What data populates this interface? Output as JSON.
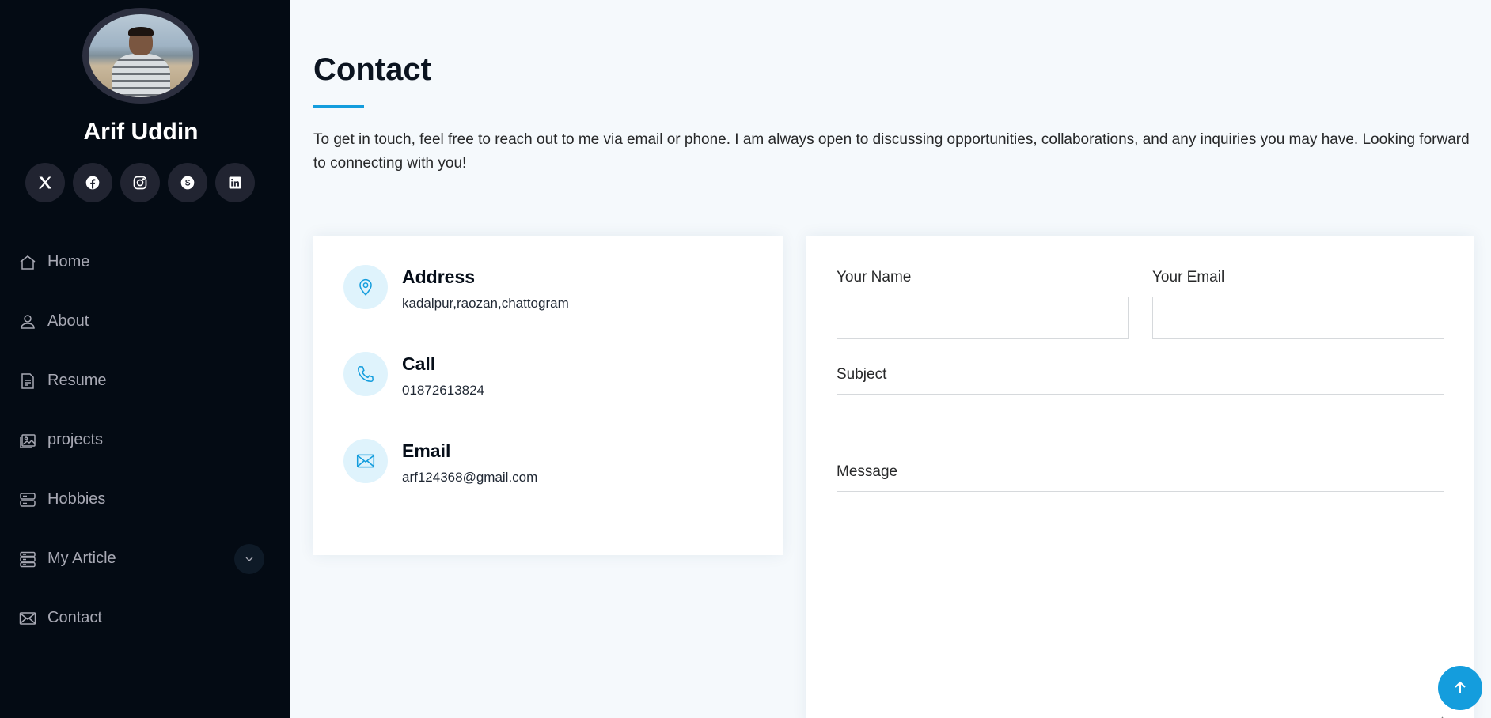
{
  "profile": {
    "name": "Arif Uddin"
  },
  "socials": [
    {
      "icon": "x-twitter-icon"
    },
    {
      "icon": "facebook-icon"
    },
    {
      "icon": "instagram-icon"
    },
    {
      "icon": "skype-icon"
    },
    {
      "icon": "linkedin-icon"
    }
  ],
  "nav": {
    "items": [
      {
        "label": "Home",
        "icon": "house-icon"
      },
      {
        "label": "About",
        "icon": "person-icon"
      },
      {
        "label": "Resume",
        "icon": "file-text-icon"
      },
      {
        "label": "projects",
        "icon": "images-icon"
      },
      {
        "label": "Hobbies",
        "icon": "server-icon"
      },
      {
        "label": "My Article",
        "icon": "menu-stack-icon"
      },
      {
        "label": "Contact",
        "icon": "envelope-icon"
      }
    ]
  },
  "main": {
    "title": "Contact",
    "intro": "To get in touch, feel free to reach out to me via email or phone. I am always open to discussing opportunities, collaborations, and any inquiries you may have. Looking forward to connecting with you!"
  },
  "info": {
    "address": {
      "title": "Address",
      "value": "kadalpur,raozan,chattogram"
    },
    "call": {
      "title": "Call",
      "value": "01872613824"
    },
    "email": {
      "title": "Email",
      "value": "arf124368@gmail.com"
    }
  },
  "form": {
    "name_label": "Your Name",
    "name_value": "",
    "email_label": "Your Email",
    "email_value": "",
    "subject_label": "Subject",
    "subject_value": "",
    "message_label": "Message",
    "message_value": ""
  },
  "colors": {
    "sidebar_bg": "#040b14",
    "accent": "#149ddd",
    "main_bg": "#f5f9fc"
  }
}
